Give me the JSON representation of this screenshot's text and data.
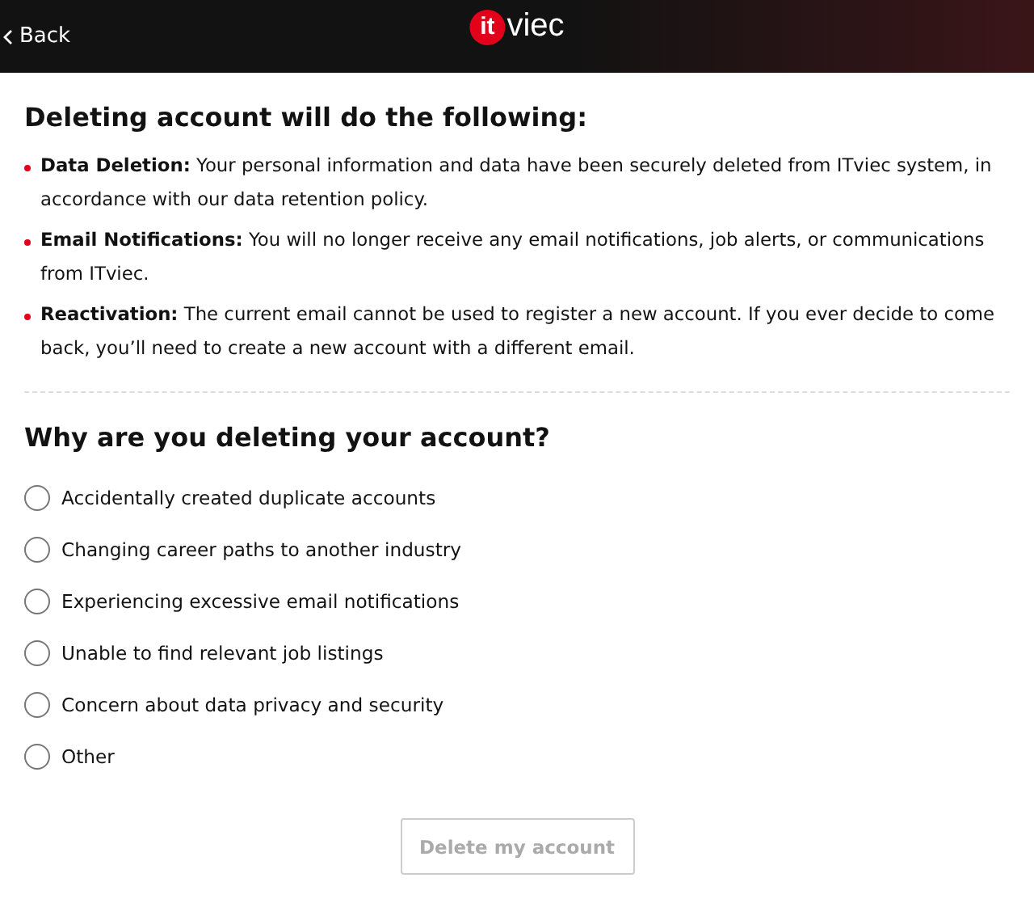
{
  "header": {
    "back": "Back",
    "logo": {
      "mark": "it",
      "word": "viec"
    }
  },
  "effects": {
    "title": "Deleting account will do the following:",
    "items": [
      {
        "text": "**Data Deletion:** Your personal information and data have been securely deleted from ITviec system, in accordance with our data retention policy."
      },
      {
        "text": "**Email Notifications:** You will no longer receive any email notifications, job alerts, or communications from ITviec."
      },
      {
        "text": "**Reactivation:** The current email cannot be used to register a new account. If you ever decide to come back, you’ll need to create a new account with a different email."
      }
    ]
  },
  "reasons": {
    "title": "Why are you deleting your account?",
    "options": [
      {
        "label": "Accidentally created duplicate accounts",
        "selected": false
      },
      {
        "label": "Changing career paths to another industry",
        "selected": false
      },
      {
        "label": "Experiencing excessive email notifications",
        "selected": false
      },
      {
        "label": "Unable to find relevant job listings",
        "selected": false
      },
      {
        "label": "Concern about data privacy and security",
        "selected": false
      },
      {
        "label": "Other",
        "selected": false
      }
    ]
  },
  "submit": {
    "label": "Delete my account",
    "disabled": true
  }
}
